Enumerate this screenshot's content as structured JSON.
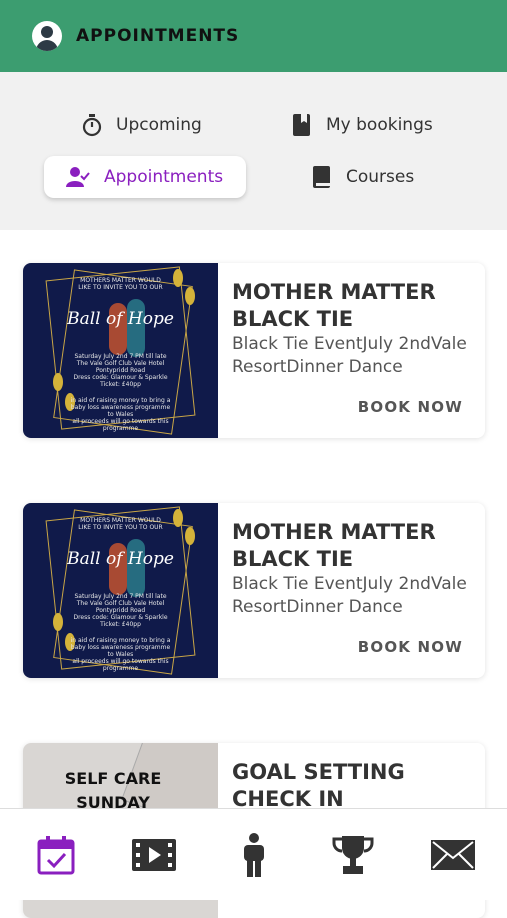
{
  "header": {
    "title": "APPOINTMENTS",
    "accent": "#3c9d70"
  },
  "tabs": {
    "upcoming": "Upcoming",
    "bookings": "My bookings",
    "appointments": "Appointments",
    "courses": "Courses",
    "active_color": "#8a1fbf"
  },
  "cards": [
    {
      "title": "MOTHER MATTER BLACK TIE",
      "description": "Black Tie EventJuly 2ndVale ResortDinner Dance",
      "action": "BOOK NOW",
      "image": {
        "top_text": "MOTHERS MATTER WOULD LIKE TO INVITE YOU TO OUR",
        "script": "Ball of Hope",
        "details": "Saturday July 2nd  7 PM till late\nThe Vale Golf Club Vale Hotel Pontypridd Road\nDress code: Glamour & Sparkle\nTicket: £40pp",
        "bottom": "in aid of raising money to bring a baby loss awareness programme to Wales\nall proceeds will go towards this programme"
      }
    },
    {
      "title": "MOTHER MATTER BLACK TIE",
      "description": "Black Tie EventJuly 2ndVale ResortDinner Dance",
      "action": "BOOK NOW",
      "image": {
        "top_text": "MOTHERS MATTER WOULD LIKE TO INVITE YOU TO OUR",
        "script": "Ball of Hope",
        "details": "Saturday July 2nd  7 PM till late\nThe Vale Golf Club Vale Hotel Pontypridd Road\nDress code: Glamour & Sparkle\nTicket: £40pp",
        "bottom": "in aid of raising money to bring a baby loss awareness programme to Wales\nall proceeds will go towards this programme"
      }
    },
    {
      "title": "GOAL SETTING CHECK IN",
      "image": {
        "line1": "SELF CARE",
        "line2": "SUNDAY"
      }
    }
  ],
  "nav": {
    "items": [
      "calendar-icon",
      "video-icon",
      "person-icon",
      "trophy-icon",
      "mail-icon"
    ],
    "active_color": "#8a1fbf"
  }
}
